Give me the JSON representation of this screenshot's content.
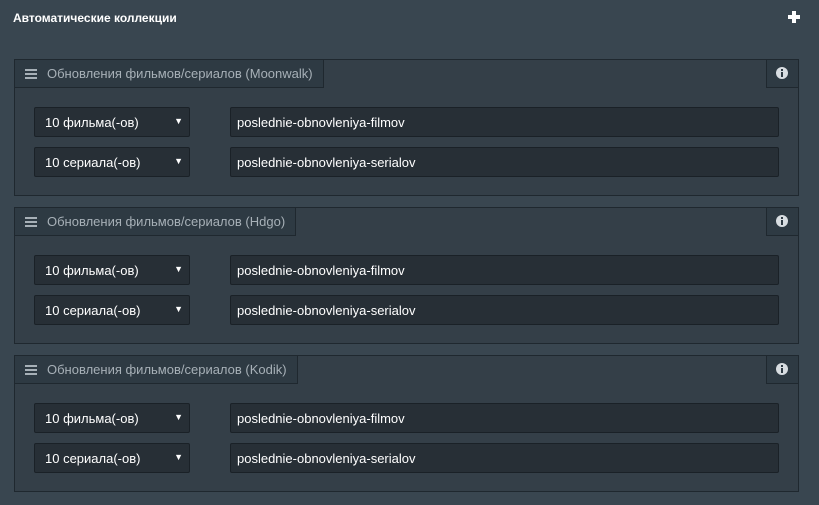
{
  "header": {
    "title": "Автоматические коллекции",
    "add_icon": "plus-icon"
  },
  "panels": [
    {
      "title": "Обновления фильмов/сериалов (Moonwalk)",
      "rows": [
        {
          "select": "10 фильма(-ов)",
          "slug": "poslednie-obnovleniya-filmov"
        },
        {
          "select": "10 сериала(-ов)",
          "slug": "poslednie-obnovleniya-serialov"
        }
      ]
    },
    {
      "title": "Обновления фильмов/сериалов (Hdgo)",
      "rows": [
        {
          "select": "10 фильма(-ов)",
          "slug": "poslednie-obnovleniya-filmov"
        },
        {
          "select": "10 сериала(-ов)",
          "slug": "poslednie-obnovleniya-serialov"
        }
      ]
    },
    {
      "title": "Обновления фильмов/сериалов (Kodik)",
      "rows": [
        {
          "select": "10 фильма(-ов)",
          "slug": "poslednie-obnovleniya-filmov"
        },
        {
          "select": "10 сериала(-ов)",
          "slug": "poslednie-obnovleniya-serialov"
        }
      ]
    }
  ],
  "icons": {
    "drag": "menu-icon",
    "info": "info-icon",
    "dropdown": "caret-down-icon"
  },
  "colors": {
    "background": "#394650",
    "panel_header": "#2e3a43",
    "input_background": "#272f36"
  }
}
